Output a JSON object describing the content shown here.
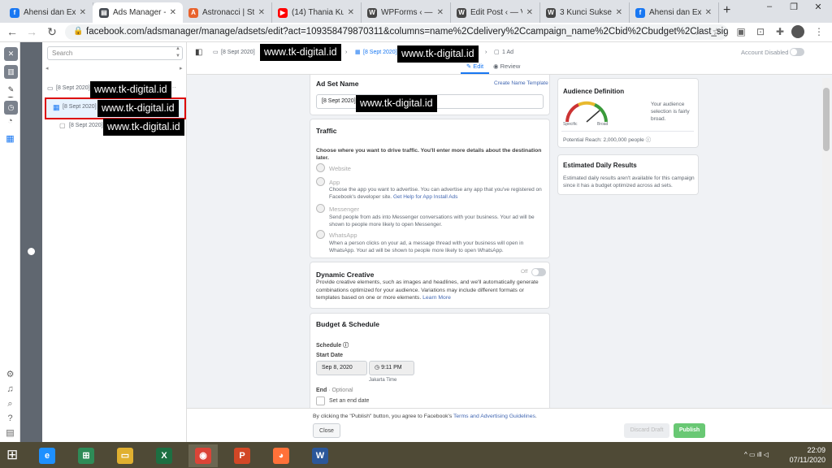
{
  "browser": {
    "tabs": [
      {
        "title": "Ahensi dan Ex",
        "icon": "facebook-icon",
        "color": "#1877f2"
      },
      {
        "title": "Ads Manager -",
        "icon": "ads-manager-icon",
        "color": "#444950",
        "active": true
      },
      {
        "title": "Astronacci | Sto",
        "icon": "astronacci-icon",
        "color": "#e8622c"
      },
      {
        "title": "(14) Thania Ku",
        "icon": "youtube-icon",
        "color": "#ff0000"
      },
      {
        "title": "WPForms ‹ — V",
        "icon": "wordpress-icon",
        "color": "#464646"
      },
      {
        "title": "Edit Post ‹ — V",
        "icon": "wordpress-icon",
        "color": "#464646"
      },
      {
        "title": "3 Kunci Sukses",
        "icon": "wordpress-icon",
        "color": "#464646"
      },
      {
        "title": "Ahensi dan Ex",
        "icon": "facebook-icon",
        "color": "#1877f2"
      }
    ],
    "new_tab": "+",
    "window_controls": [
      "–",
      "❐",
      "✕"
    ],
    "url": "facebook.com/adsmanager/manage/adsets/edit?act=109358479870311&columns=name%2Cdelivery%2Ccampaign_name%2Cbid%2Cbudget%2Clast_signifi..."
  },
  "tree": {
    "search_placeholder": "Search",
    "campaign": "[8 Sept 2020]",
    "adset": "[8 Sept 2020]",
    "ad": "[8 Sept 2020]",
    "more": "···"
  },
  "watermark": "www.tk-digital.id",
  "topbar": {
    "campaign_crumb": "[8 Sept 2020]",
    "adset_crumb": "[8 Sept 2020]",
    "ad_crumb": "1 Ad",
    "edit_label": "Edit",
    "review_label": "Review",
    "account_status": "Account Disabled"
  },
  "adset_name": {
    "heading": "Ad Set Name",
    "template_link": "Create Name Template",
    "value": "[8 Sept 2020]",
    "value_suffix": "a"
  },
  "traffic": {
    "heading": "Traffic",
    "prompt": "Choose where you want to drive traffic. You'll enter more details about the destination later.",
    "options": [
      {
        "label": "Website",
        "desc": ""
      },
      {
        "label": "App",
        "desc": "Choose the app you want to advertise. You can advertise any app that you've registered on Facebook's developer site.",
        "link": "Get Help for App Install Ads"
      },
      {
        "label": "Messenger",
        "desc": "Send people from ads into Messenger conversations with your business. Your ad will be shown to people more likely to open Messenger."
      },
      {
        "label": "WhatsApp",
        "desc": "When a person clicks on your ad, a message thread with your business will open in WhatsApp. Your ad will be shown to people more likely to open WhatsApp."
      }
    ]
  },
  "dynamic_creative": {
    "heading": "Dynamic Creative",
    "toggle_label": "Off",
    "desc": "Provide creative elements, such as images and headlines, and we'll automatically generate combinations optimized for your audience. Variations may include different formats or templates based on one or more elements.",
    "link": "Learn More"
  },
  "budget": {
    "heading": "Budget & Schedule",
    "schedule_label": "Schedule",
    "start_label": "Start Date",
    "start_date": "Sep 8, 2020",
    "start_time": "9:11 PM",
    "timezone": "Jakarta Time",
    "end_label": "End",
    "end_optional": "· Optional",
    "end_checkbox": "Set an end date"
  },
  "audience": {
    "heading": "Audience Definition",
    "specific": "Specific",
    "broad": "Broad",
    "note": "Your audience selection is fairly broad.",
    "reach": "Potential Reach: 2,000,000 people"
  },
  "daily_results": {
    "heading": "Estimated Daily Results",
    "desc": "Estimated daily results aren't available for this campaign since it has a budget optimized across ad sets."
  },
  "footer": {
    "notice_prefix": "By clicking the \"Publish\" button, you agree to Facebook's ",
    "notice_link": "Terms and Advertising Guidelines",
    "notice_suffix": ".",
    "close": "Close",
    "discard": "Discard Draft",
    "publish": "Publish"
  },
  "taskbar": {
    "apps": [
      {
        "icon": "internet-explorer-icon",
        "glyph": "e",
        "color": "#1e90ff"
      },
      {
        "icon": "store-icon",
        "glyph": "⊞",
        "color": "#2e8b57"
      },
      {
        "icon": "file-explorer-icon",
        "glyph": "▭",
        "color": "#e0b030"
      },
      {
        "icon": "excel-icon",
        "glyph": "X",
        "color": "#1d6f42"
      },
      {
        "icon": "chrome-icon",
        "glyph": "◉",
        "color": "#db4437"
      },
      {
        "icon": "powerpoint-icon",
        "glyph": "P",
        "color": "#d24726"
      },
      {
        "icon": "firefox-icon",
        "glyph": "◕",
        "color": "#ff7139"
      },
      {
        "icon": "word-icon",
        "glyph": "W",
        "color": "#2b579a"
      }
    ],
    "time": "22:09",
    "date": "07/11/2020"
  },
  "colors": {
    "accent": "#1877f2",
    "publish": "#69c874",
    "highlight_border": "#dd0000"
  }
}
